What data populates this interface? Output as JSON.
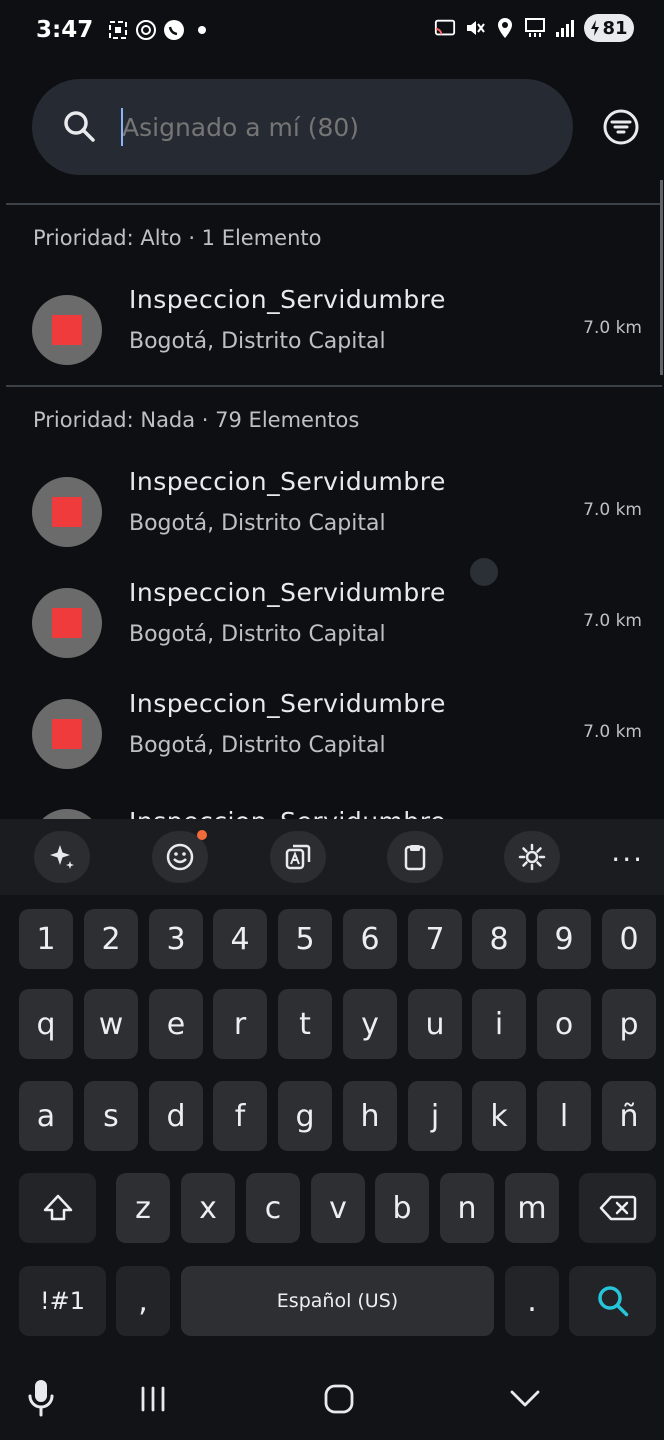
{
  "status": {
    "time": "3:47",
    "battery": "81"
  },
  "search": {
    "placeholder": "Asignado a mí (80)"
  },
  "sections": [
    {
      "header": "Prioridad: Alto · 1 Elemento"
    },
    {
      "header": "Prioridad: Nada · 79 Elementos"
    }
  ],
  "items": [
    {
      "title": "Inspeccion_Servidumbre",
      "subtitle": "Bogotá, Distrito Capital",
      "distance": "7.0 km"
    },
    {
      "title": "Inspeccion_Servidumbre",
      "subtitle": "Bogotá, Distrito Capital",
      "distance": "7.0 km"
    },
    {
      "title": "Inspeccion_Servidumbre",
      "subtitle": "Bogotá, Distrito Capital",
      "distance": "7.0 km"
    },
    {
      "title": "Inspeccion_Servidumbre",
      "subtitle": "Bogotá, Distrito Capital",
      "distance": "7.0 km"
    },
    {
      "title": "Inspeccion_Servidumbre"
    }
  ],
  "keyboard": {
    "numbers": [
      "1",
      "2",
      "3",
      "4",
      "5",
      "6",
      "7",
      "8",
      "9",
      "0"
    ],
    "row1": [
      "q",
      "w",
      "e",
      "r",
      "t",
      "y",
      "u",
      "i",
      "o",
      "p"
    ],
    "row2": [
      "a",
      "s",
      "d",
      "f",
      "g",
      "h",
      "j",
      "k",
      "l",
      "ñ"
    ],
    "row3": [
      "z",
      "x",
      "c",
      "v",
      "b",
      "n",
      "m"
    ],
    "symbols_label": "!#1",
    "comma": ",",
    "space_label": "Español (US)",
    "period": ".",
    "more": "···"
  },
  "colors": {
    "accent": "#26c6da",
    "item_marker": "#ef3b3b",
    "badge_dot": "#f26b3a"
  }
}
